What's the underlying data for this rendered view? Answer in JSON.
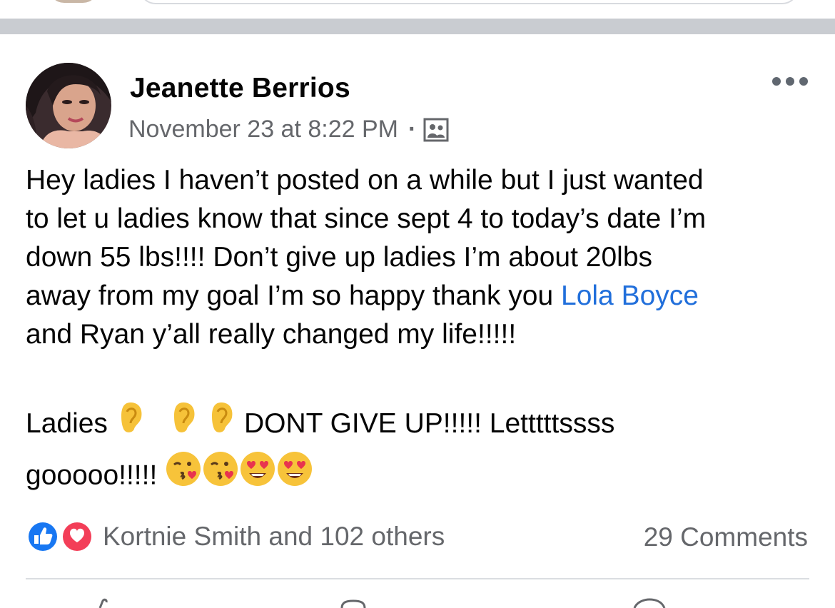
{
  "post": {
    "author": "Jeanette Berrios",
    "timestamp": "November 23 at 8:22 PM",
    "separator_dot": "·",
    "audience_icon": "group-icon",
    "more_icon": "more-options-icon",
    "body": {
      "line1": "Hey ladies I haven’t posted on a while but I just wanted",
      "line2": "to let u ladies know that since sept 4 to today’s date I’m",
      "line3": "down 55 lbs!!!! Don’t give up ladies I’m about 20lbs",
      "line4_before": "away from my goal I’m so happy thank you ",
      "mention": "Lola Boyce",
      "line5": "and Ryan y’all really changed my life!!!!!",
      "para2_start": "Ladies ",
      "para2_mid": " DONT GIVE UP!!!!! Letttttssss",
      "para2_end": "gooooo!!!!! ",
      "emoji_ears": [
        "ear-emoji",
        "ear-emoji",
        "ear-emoji"
      ],
      "emoji_end": [
        "kissing-heart-emoji",
        "kissing-heart-emoji",
        "heart-eyes-emoji",
        "heart-eyes-emoji"
      ]
    },
    "reactions": {
      "icons": [
        "like-icon",
        "love-icon"
      ],
      "text": "Kortnie Smith and 102 others"
    },
    "comments": "29 Comments"
  },
  "colors": {
    "link": "#216fdb",
    "secondary_text": "#65676b",
    "like_blue": "#1877f2",
    "love_red": "#f33e58"
  }
}
